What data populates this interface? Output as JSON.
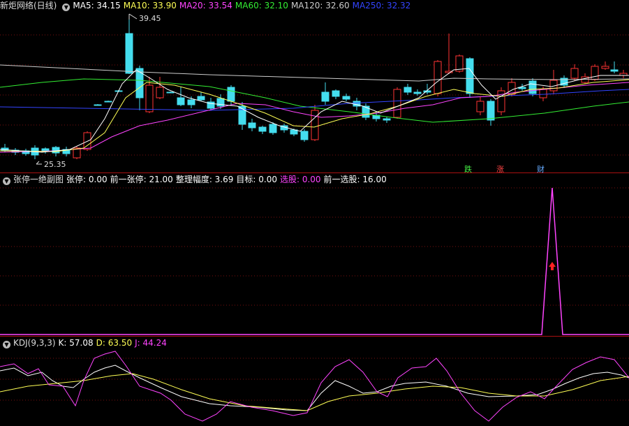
{
  "main": {
    "title": "新炬网络(日线)",
    "ma": [
      {
        "label": "MA5: 34.15",
        "color": "#ffffff"
      },
      {
        "label": "MA10: 33.90",
        "color": "#ffff55"
      },
      {
        "label": "MA20: 33.54",
        "color": "#ff44ff"
      },
      {
        "label": "MA60: 32.10",
        "color": "#33ee33"
      },
      {
        "label": "MA120: 32.60",
        "color": "#cccccc"
      },
      {
        "label": "MA250: 32.32",
        "color": "#3344ff"
      }
    ],
    "high_label": "39.45",
    "low_label": "25.35",
    "tags": [
      {
        "text": "跌",
        "color": "#44ee44"
      },
      {
        "text": "涨",
        "color": "#ff4444"
      },
      {
        "text": "财",
        "color": "#66aaff"
      }
    ]
  },
  "sub": {
    "title": "张停一绝副图",
    "fields": [
      {
        "label": "张停: 0.00",
        "color": "#ffffff"
      },
      {
        "label": "前一张停: 21.00",
        "color": "#ffffff"
      },
      {
        "label": "整理幅度: 3.69",
        "color": "#ffffff"
      },
      {
        "label": "目标: 0.00",
        "color": "#ffffff"
      },
      {
        "label": "选股: 0.00",
        "color": "#ff44ff"
      },
      {
        "label": "前一选股: 16.00",
        "color": "#ffffff"
      }
    ]
  },
  "kdj": {
    "title": "KDJ(9,3,3)",
    "fields": [
      {
        "label": "K: 57.08",
        "color": "#ffffff"
      },
      {
        "label": "D: 63.50",
        "color": "#ffff55"
      },
      {
        "label": "J: 44.24",
        "color": "#ff44ff"
      }
    ]
  },
  "colors": {
    "up": "#ff3333",
    "down": "#44ddee",
    "grid": "#7a1010",
    "separator": "#aa1111"
  }
}
